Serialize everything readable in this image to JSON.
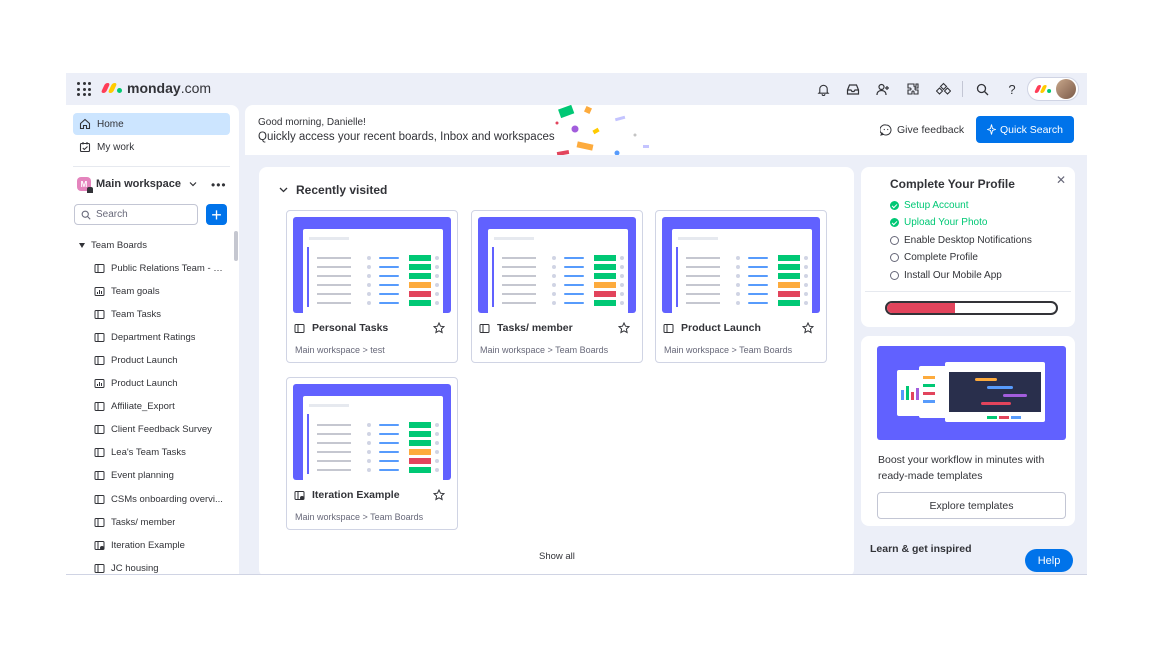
{
  "brand": {
    "name": "monday",
    "domain": ".com",
    "colors": [
      "#ff3d57",
      "#ffcb00",
      "#00ca72"
    ]
  },
  "topbar": {
    "icons": [
      "bell-icon",
      "inbox-icon",
      "invite-icon",
      "apps-icon",
      "integrations-icon",
      "search-icon",
      "help-icon"
    ]
  },
  "sidebar": {
    "home_label": "Home",
    "mywork_label": "My work",
    "workspace": {
      "badge": "M",
      "name": "Main workspace"
    },
    "search_placeholder": "Search",
    "folder": "Team Boards",
    "boards": [
      {
        "label": "Public Relations Team - R...",
        "icon": "board-icon"
      },
      {
        "label": "Team goals",
        "icon": "dashboard-icon"
      },
      {
        "label": "Team Tasks",
        "icon": "board-icon"
      },
      {
        "label": "Department Ratings",
        "icon": "board-icon"
      },
      {
        "label": "Product Launch",
        "icon": "board-icon"
      },
      {
        "label": "Product Launch",
        "icon": "dashboard-icon"
      },
      {
        "label": "Affiliate_Export",
        "icon": "board-icon"
      },
      {
        "label": "Client Feedback Survey",
        "icon": "board-icon"
      },
      {
        "label": "Lea's Team Tasks",
        "icon": "board-icon"
      },
      {
        "label": "Event planning",
        "icon": "board-icon"
      },
      {
        "label": "CSMs onboarding overvi...",
        "icon": "board-icon"
      },
      {
        "label": "Tasks/ member",
        "icon": "board-icon"
      },
      {
        "label": "Iteration Example",
        "icon": "board-share-icon"
      },
      {
        "label": "JC housing",
        "icon": "board-icon"
      }
    ]
  },
  "greeting": {
    "hello": "Good morning, Danielle!",
    "subtitle": "Quickly access your recent boards, Inbox and workspaces",
    "feedback": "Give feedback",
    "quick_search": "Quick Search"
  },
  "recent": {
    "title": "Recently visited",
    "cards": [
      {
        "title": "Personal Tasks",
        "path": "Main workspace > test"
      },
      {
        "title": "Tasks/ member",
        "path": "Main workspace > Team Boards"
      },
      {
        "title": "Product Launch",
        "path": "Main workspace > Team Boards"
      },
      {
        "title": "Iteration Example",
        "path": "Main workspace > Team Boards"
      }
    ],
    "show_all": "Show all"
  },
  "profile": {
    "title": "Complete Your Profile",
    "items": [
      {
        "label": "Setup Account",
        "done": true
      },
      {
        "label": "Upload Your Photo",
        "done": true
      },
      {
        "label": "Enable Desktop Notifications",
        "done": false
      },
      {
        "label": "Complete Profile",
        "done": false
      },
      {
        "label": "Install Our Mobile App",
        "done": false
      }
    ],
    "progress": 0.4
  },
  "templates": {
    "text": "Boost your workflow in minutes with ready-made templates",
    "button": "Explore templates"
  },
  "learn": "Learn & get inspired",
  "help": "Help"
}
